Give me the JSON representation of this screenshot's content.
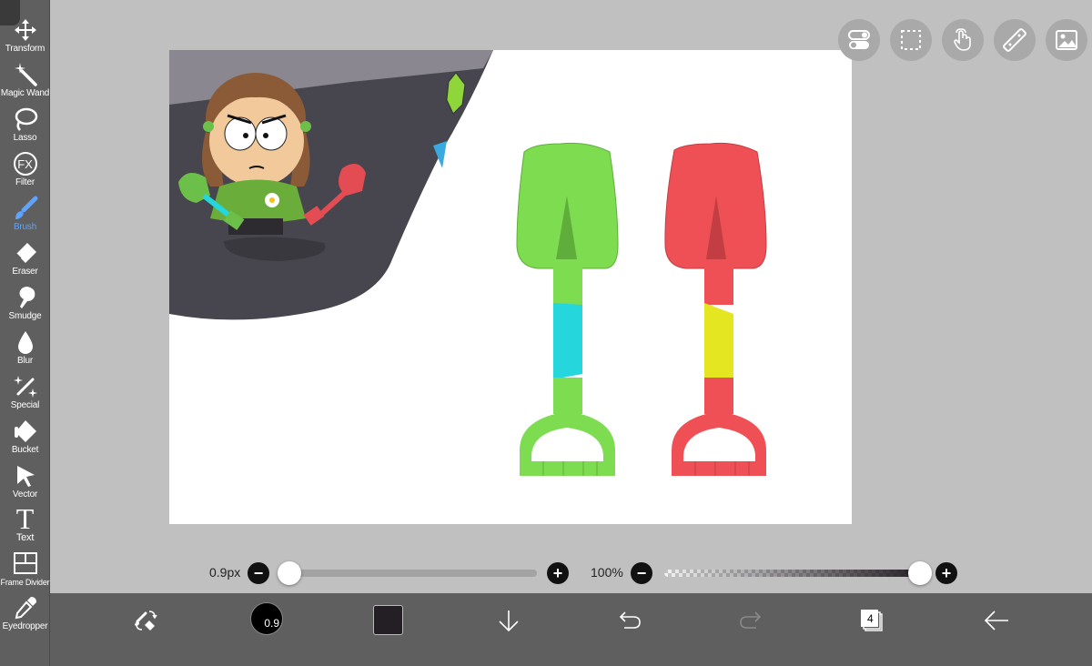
{
  "toolbar": {
    "items": [
      {
        "label": "Transform",
        "icon": "move-icon"
      },
      {
        "label": "Magic Wand",
        "icon": "magic-wand-icon"
      },
      {
        "label": "Lasso",
        "icon": "lasso-icon"
      },
      {
        "label": "Filter",
        "icon": "fx-icon",
        "glyph": "FX"
      },
      {
        "label": "Brush",
        "icon": "brush-icon"
      },
      {
        "label": "Eraser",
        "icon": "eraser-icon"
      },
      {
        "label": "Smudge",
        "icon": "smudge-icon"
      },
      {
        "label": "Blur",
        "icon": "drop-icon"
      },
      {
        "label": "Special",
        "icon": "sparkle-icon"
      },
      {
        "label": "Bucket",
        "icon": "bucket-icon"
      },
      {
        "label": "Vector",
        "icon": "cursor-icon"
      },
      {
        "label": "Text",
        "icon": "text-icon",
        "glyph": "T"
      },
      {
        "label": "Frame Divider",
        "icon": "frame-icon"
      },
      {
        "label": "Eyedropper",
        "icon": "eyedropper-icon"
      }
    ],
    "active": "Brush",
    "active_color": "#5da3ff"
  },
  "sliders": {
    "size_label": "0.9px",
    "opacity_label": "100%",
    "size_value": 0,
    "opacity_value": 1.0
  },
  "bottombar": {
    "brush_size_text": "0.9",
    "current_color": "#231f24",
    "layer_count": "4"
  },
  "colors": {
    "shovel_green": "#7ddc50",
    "shovel_red": "#ee5055",
    "band_cyan": "#25d6dc",
    "band_yellow": "#e3e621"
  }
}
